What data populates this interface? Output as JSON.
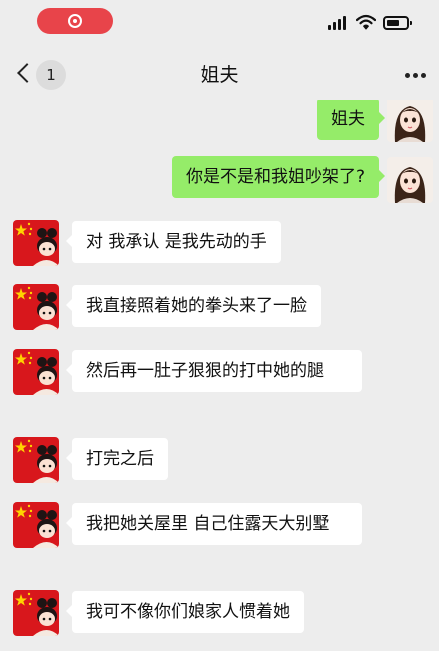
{
  "status_bar": {
    "recording_indicator": "screen-record-icon",
    "icons": [
      "cellular-signal-icon",
      "wifi-icon",
      "battery-icon"
    ]
  },
  "nav": {
    "back_icon": "chevron-left-icon",
    "unread_count": "1",
    "title": "姐夫",
    "more_icon": "more-dots-icon"
  },
  "colors": {
    "background": "#ededed",
    "outgoing_bubble": "#95ec69",
    "incoming_bubble": "#ffffff",
    "recording_pill": "#e8444a"
  },
  "messages": [
    {
      "side": "outgoing",
      "text": "姐夫"
    },
    {
      "side": "outgoing",
      "text": "你是不是和我姐吵架了?"
    },
    {
      "side": "incoming",
      "text": "对 我承认 是我先动的手"
    },
    {
      "side": "incoming",
      "text": "我直接照着她的拳头来了一脸"
    },
    {
      "side": "incoming",
      "text": "然后再一肚子狠狠的打中她的腿"
    },
    {
      "side": "incoming",
      "text": "打完之后"
    },
    {
      "side": "incoming",
      "text": "我把她关屋里 自己住露天大别墅"
    },
    {
      "side": "incoming",
      "text": "我可不像你们娘家人惯着她"
    }
  ]
}
